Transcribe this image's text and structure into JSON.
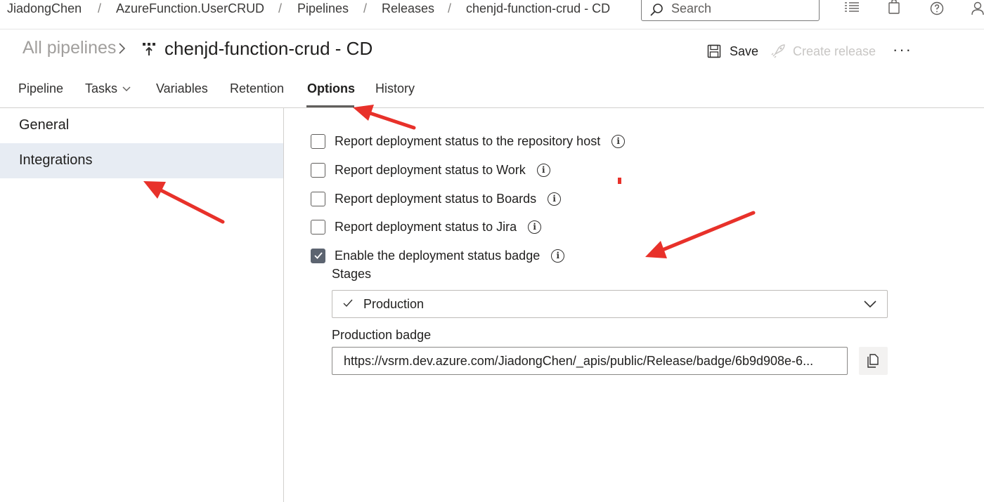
{
  "breadcrumb": {
    "items": [
      "JiadongChen",
      "AzureFunction.UserCRUD",
      "Pipelines",
      "Releases",
      "chenjd-function-crud - CD"
    ],
    "separator": "/"
  },
  "search": {
    "placeholder": "Search"
  },
  "top_icons": [
    "task-list-icon",
    "shopping-bag-icon",
    "help-icon",
    "user-settings-icon"
  ],
  "header": {
    "all_pipelines": "All pipelines",
    "title": "chenjd-function-crud - CD",
    "save_label": "Save",
    "create_release_label": "Create release",
    "more_label": "···"
  },
  "tabs": [
    {
      "label": "Pipeline"
    },
    {
      "label": "Tasks"
    },
    {
      "label": "Variables"
    },
    {
      "label": "Retention"
    },
    {
      "label": "Options",
      "active": true
    },
    {
      "label": "History"
    }
  ],
  "left_nav": [
    {
      "label": "General"
    },
    {
      "label": "Integrations",
      "selected": true
    }
  ],
  "options": [
    {
      "label": "Report deployment status to the repository host",
      "checked": false
    },
    {
      "label": "Report deployment status to Work",
      "checked": false
    },
    {
      "label": "Report deployment status to Boards",
      "checked": false
    },
    {
      "label": "Report deployment status to Jira",
      "checked": false
    },
    {
      "label": "Enable the deployment status badge",
      "checked": true
    }
  ],
  "stages": {
    "label": "Stages",
    "selected": "Production"
  },
  "badge": {
    "label": "Production badge",
    "url": "https://vsrm.dev.azure.com/JiadongChen/_apis/public/Release/badge/6b9d908e-6..."
  },
  "colors": {
    "accent_selected_bg": "#e7ecf3",
    "checkbox_checked": "#5c6470",
    "annotation_arrow": "#e8312a"
  }
}
